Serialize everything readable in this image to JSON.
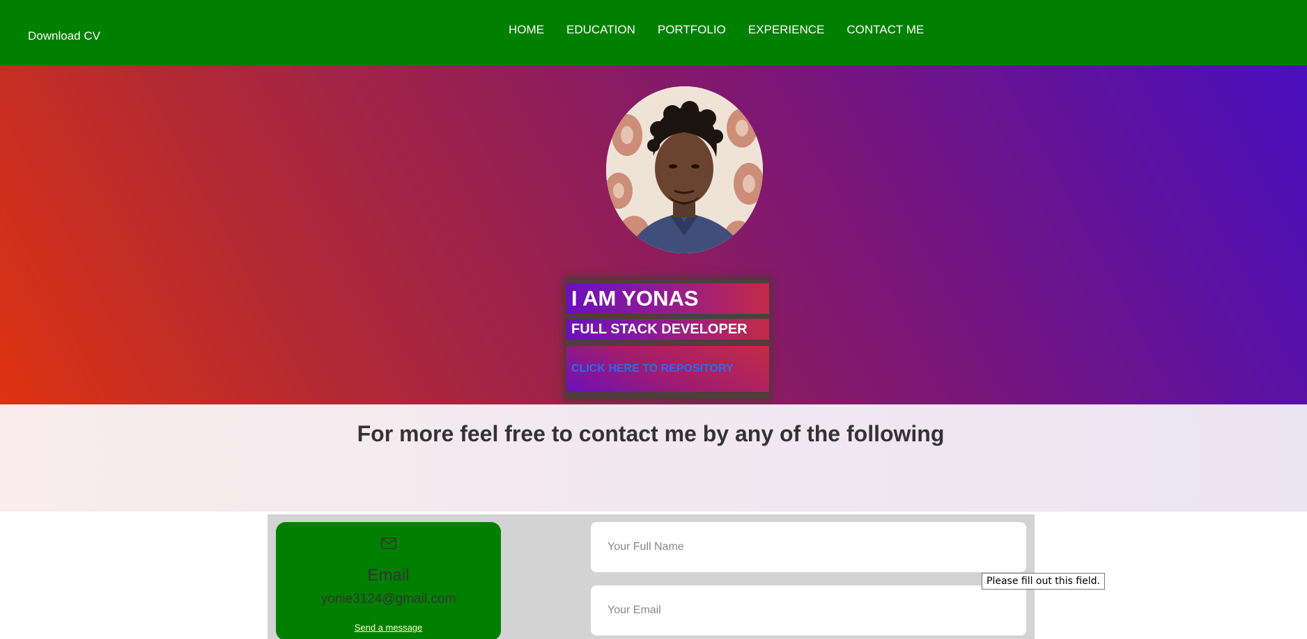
{
  "nav": {
    "download_label": "Download CV",
    "links": [
      "HOME",
      "EDUCATION",
      "PORTFOLIO",
      "EXPERIENCE",
      "CONTACT ME"
    ]
  },
  "hero": {
    "name": "I AM YONAS",
    "role": "FULL STACK DEVELOPER",
    "repo_link": "CLICK HERE TO REPOSITORY"
  },
  "contact": {
    "heading": "For more feel free to contact me by any of the following",
    "email_card": {
      "icon": "mail-icon",
      "title": "Email",
      "address": "yonie3124@gmail.com",
      "link_label": "Send a message"
    },
    "form": {
      "name_placeholder": "Your Full Name",
      "email_placeholder": "Your Email"
    }
  },
  "tooltip": "Please fill out this field.",
  "colors": {
    "nav_bg": "#008000",
    "card_bg": "#008000",
    "repo_link": "#2b6bf0",
    "form_bg": "#d3d3d3"
  }
}
